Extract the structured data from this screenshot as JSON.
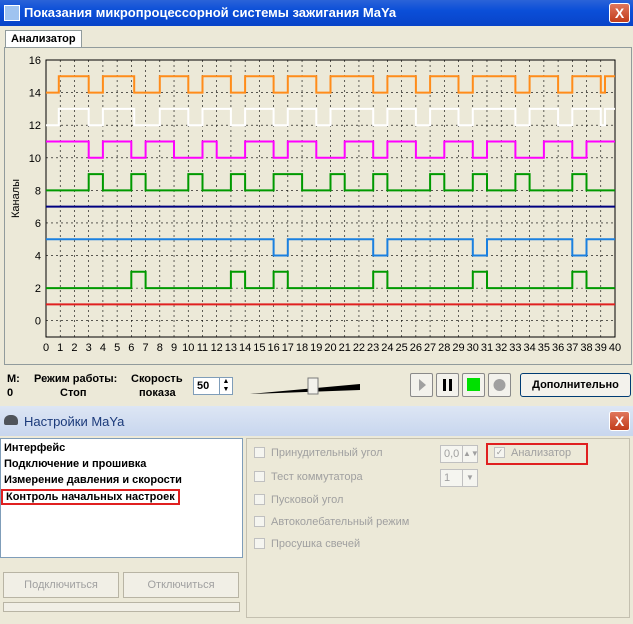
{
  "window": {
    "title": "Показания микропроцессорной системы зажигания MaYa",
    "close": "X"
  },
  "tab": {
    "label": "Анализатор"
  },
  "chart_data": {
    "type": "line",
    "ylabel": "Каналы",
    "xlim": [
      0,
      40
    ],
    "ylim": [
      -1,
      16
    ],
    "x_ticks": [
      0,
      1,
      2,
      3,
      4,
      5,
      6,
      7,
      8,
      9,
      10,
      11,
      12,
      13,
      14,
      15,
      16,
      17,
      18,
      19,
      20,
      21,
      22,
      23,
      24,
      25,
      26,
      27,
      28,
      29,
      30,
      31,
      32,
      33,
      34,
      35,
      36,
      37,
      38,
      39,
      40
    ],
    "y_ticks": [
      0,
      2,
      4,
      6,
      8,
      10,
      12,
      14,
      16
    ],
    "series": [
      {
        "color": "#ff8c1a",
        "low": 14,
        "high": 15,
        "high_intervals": [
          [
            0.9,
            3
          ],
          [
            4,
            6.2
          ],
          [
            8,
            10
          ],
          [
            11,
            13
          ],
          [
            14,
            16
          ],
          [
            17,
            19
          ],
          [
            20,
            23
          ],
          [
            24,
            26
          ],
          [
            27,
            29
          ],
          [
            30,
            33
          ],
          [
            34,
            36
          ],
          [
            37,
            39
          ],
          [
            39.3,
            40
          ]
        ]
      },
      {
        "color": "#ffffff",
        "low": 12,
        "high": 13,
        "high_intervals": [
          [
            0.9,
            3
          ],
          [
            4,
            6.2
          ],
          [
            8,
            10
          ],
          [
            11,
            13
          ],
          [
            14,
            16
          ],
          [
            17,
            19
          ],
          [
            20,
            23
          ],
          [
            24,
            26
          ],
          [
            27,
            29
          ],
          [
            30,
            33
          ],
          [
            34,
            36
          ],
          [
            37,
            39
          ],
          [
            39.3,
            40
          ]
        ]
      },
      {
        "color": "#ff00ff",
        "low": 10,
        "high": 11,
        "high_intervals": [
          [
            0,
            3
          ],
          [
            4,
            6
          ],
          [
            7,
            9
          ],
          [
            11,
            12
          ],
          [
            14,
            16
          ],
          [
            17,
            19
          ],
          [
            21,
            23
          ],
          [
            24,
            26
          ],
          [
            28,
            30
          ],
          [
            31,
            33
          ],
          [
            35,
            37
          ],
          [
            38,
            40
          ]
        ]
      },
      {
        "color": "#009900",
        "low": 8,
        "high": 9,
        "high_intervals": [
          [
            3,
            4
          ],
          [
            6,
            7
          ],
          [
            10,
            11
          ],
          [
            13,
            14
          ],
          [
            16,
            18
          ],
          [
            20,
            21
          ],
          [
            23,
            24
          ],
          [
            27,
            28
          ],
          [
            30,
            31
          ],
          [
            33,
            34
          ],
          [
            37,
            38
          ]
        ]
      },
      {
        "color": "#000080",
        "low": 7,
        "high": 7,
        "high_intervals": []
      },
      {
        "color": "#1a80e0",
        "low": 4,
        "high": 5,
        "high_intervals": [
          [
            0,
            16
          ],
          [
            17,
            23
          ],
          [
            24,
            30
          ],
          [
            31,
            37
          ],
          [
            38,
            40
          ]
        ]
      },
      {
        "color": "#009900",
        "low": 2,
        "high": 3,
        "high_intervals": [
          [
            6,
            7
          ],
          [
            13,
            14
          ],
          [
            16,
            17
          ],
          [
            23,
            24
          ],
          [
            30,
            31
          ],
          [
            37,
            38
          ]
        ]
      },
      {
        "color": "#e02020",
        "low": 1,
        "high": 1,
        "high_intervals": []
      }
    ]
  },
  "status": {
    "m_label": "M:",
    "m_value": "0",
    "mode_label": "Режим работы:",
    "mode_value": "Стоп",
    "speed_label1": "Скорость",
    "speed_label2": "показа",
    "speed_value": "50",
    "slider_level": 0.58,
    "more_button": "Дополнительно"
  },
  "settings_window": {
    "title": "Настройки MaYa",
    "close": "X",
    "menu": [
      "Интерфейс",
      "Подключение и прошивка",
      "Измерение давления и скорости",
      "Контроль начальных настроек"
    ],
    "connect_button": "Подключиться",
    "disconnect_button": "Отключиться",
    "options": {
      "forced_angle": "Принудительный угол",
      "forced_angle_value": "0,0",
      "switch_test": "Тест коммутатора",
      "switch_test_value": "1",
      "start_angle": "Пусковой угол",
      "auto_osc": "Автоколебательный режим",
      "plug_dry": "Просушка свечей",
      "analyzer": "Анализатор"
    }
  }
}
